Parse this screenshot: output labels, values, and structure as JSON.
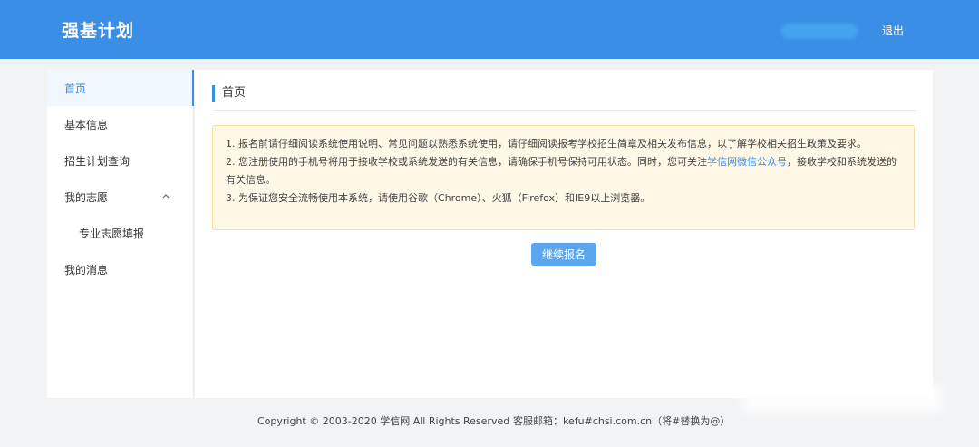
{
  "header": {
    "brand": "强基计划",
    "logout_label": "退出",
    "accent_color": "#3a8ee6"
  },
  "sidebar": {
    "items": [
      {
        "label": "首页",
        "active": true
      },
      {
        "label": "基本信息"
      },
      {
        "label": "招生计划查询"
      },
      {
        "label": "我的志愿",
        "icon": "chevron-up-icon"
      },
      {
        "label": "专业志愿填报"
      },
      {
        "label": "我的消息"
      }
    ]
  },
  "main": {
    "title": "首页",
    "notice": {
      "line1": "1. 报名前请仔细阅读系统使用说明、常见问题以熟悉系统使用，请仔细阅读报考学校招生简章及相关发布信息，以了解学校相关招生政策及要求。",
      "line2_before": "2. 您注册使用的手机号将用于接收学校或系统发送的有关信息，请确保手机号保持可用状态。同时，您可关注",
      "line2_link": "学信网微信公众号",
      "line2_after": "，接收学校和系统发送的有关信息。",
      "line3": "3. 为保证您安全流畅使用本系统，请使用谷歌（Chrome）、火狐（Firefox）和IE9以上浏览器。"
    },
    "continue_label": "继续报名"
  },
  "footer": {
    "copyright": "Copyright © 2003-2020 学信网 All Rights Reserved",
    "support": "客服邮箱：kefu#chsi.com.cn（将#替换为@）"
  }
}
